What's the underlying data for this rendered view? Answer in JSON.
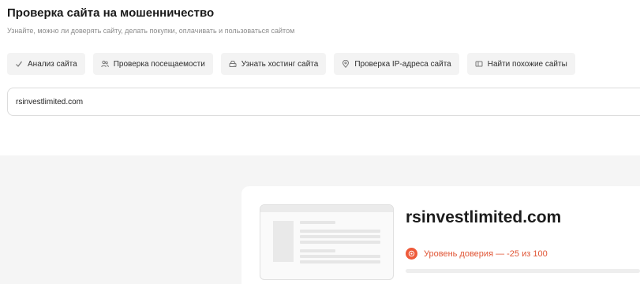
{
  "header": {
    "title": "Проверка сайта на мошенничество",
    "subtitle": "Узнайте, можно ли доверять сайту, делать покупки, оплачивать и пользоваться сайтом"
  },
  "tools": [
    {
      "label": "Анализ сайта",
      "icon": "check-icon"
    },
    {
      "label": "Проверка посещаемости",
      "icon": "users-icon"
    },
    {
      "label": "Узнать хостинг сайта",
      "icon": "server-icon"
    },
    {
      "label": "Проверка IP-адреса сайта",
      "icon": "location-pin-icon"
    },
    {
      "label": "Найти похожие сайты",
      "icon": "window-icon"
    }
  ],
  "search": {
    "value": "rsinvestlimited.com"
  },
  "result": {
    "domain": "rsinvestlimited.com",
    "trust_text": "Уровень доверия — -25 из 100",
    "trust_score": -25,
    "trust_max": 100,
    "trust_color": "#ee5a3a"
  }
}
